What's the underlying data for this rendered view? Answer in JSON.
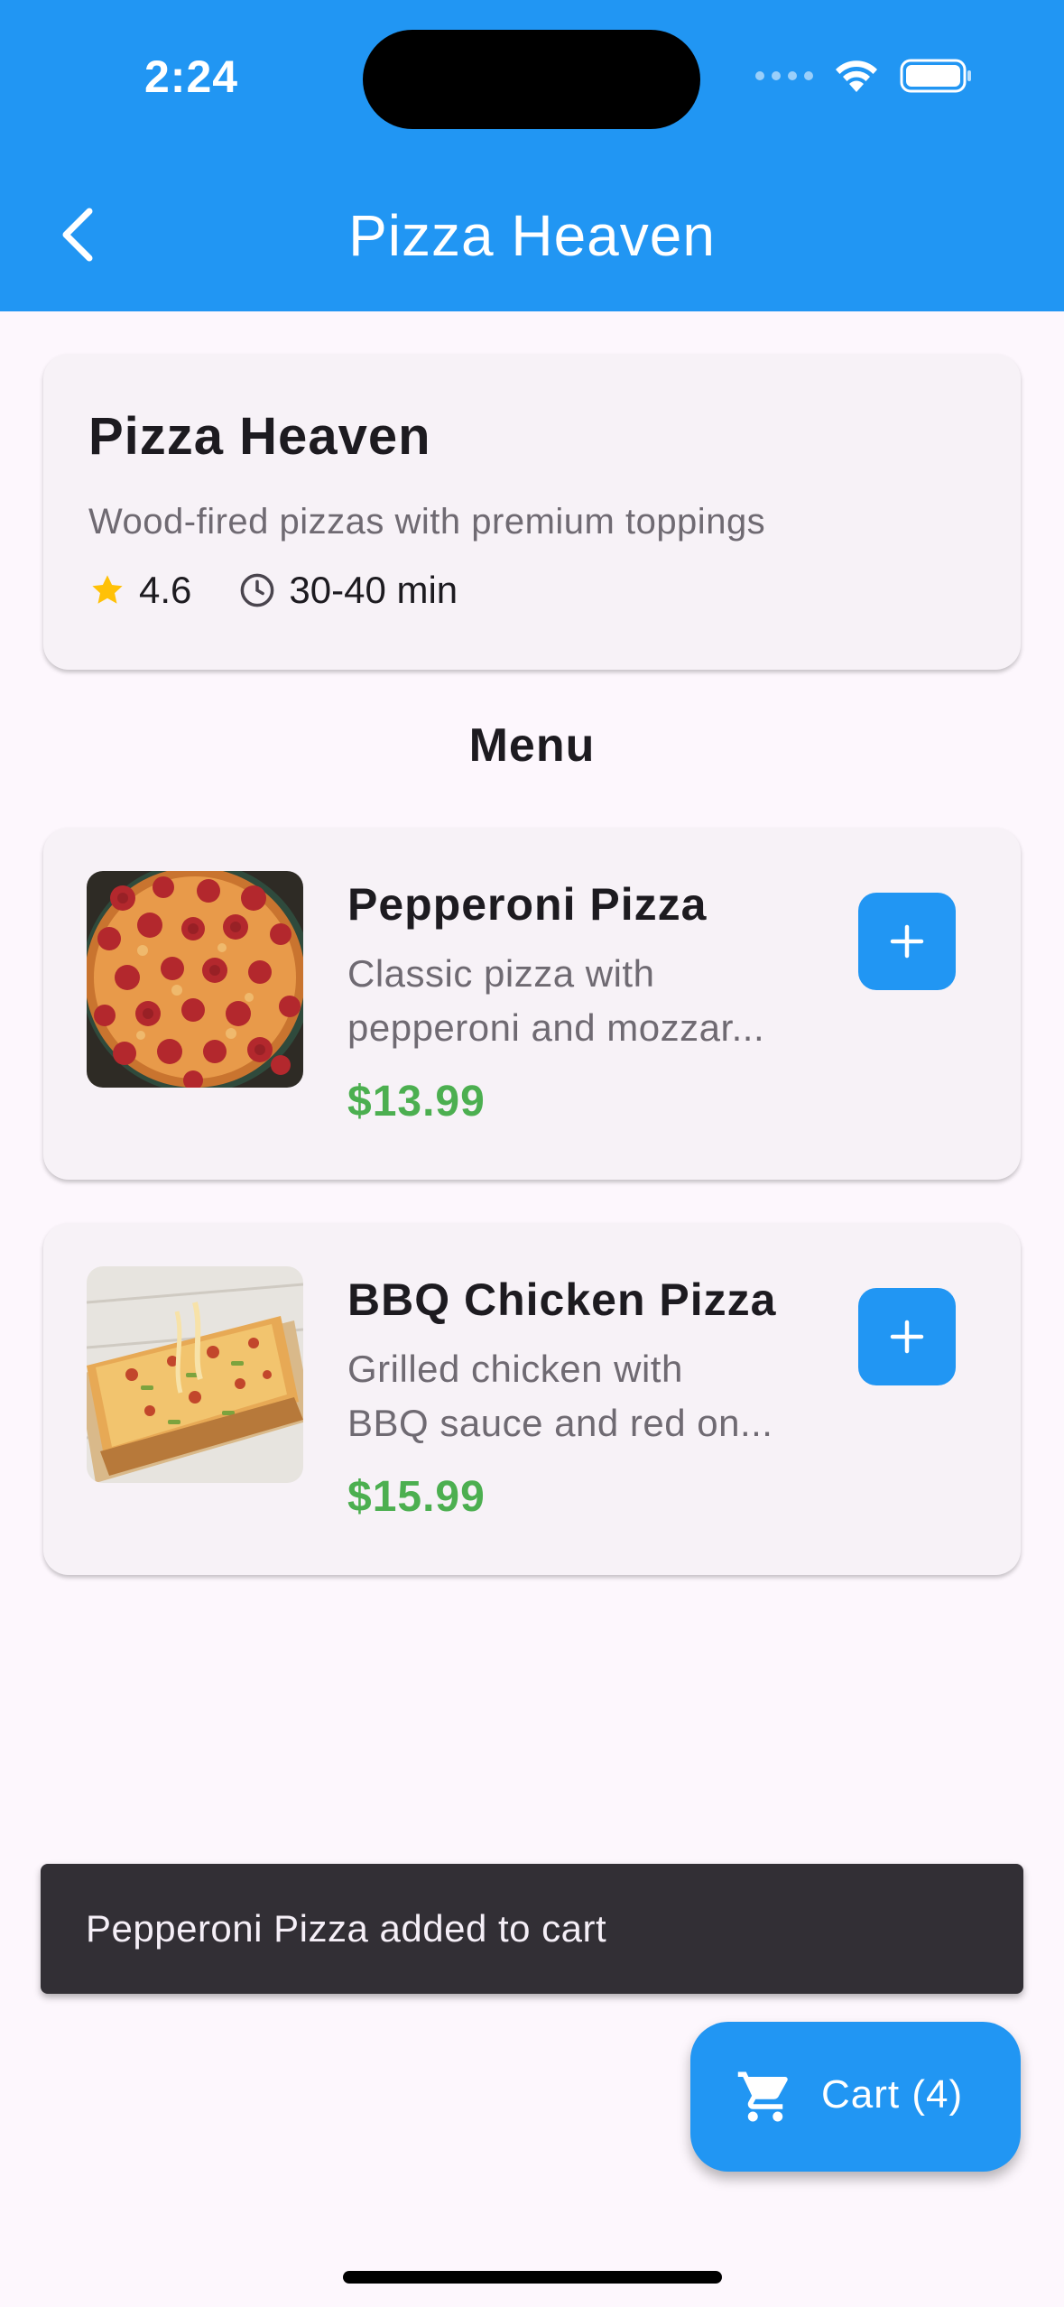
{
  "status_bar": {
    "time": "2:24"
  },
  "header": {
    "title": "Pizza Heaven",
    "back_icon": "chevron-left-icon"
  },
  "restaurant": {
    "name": "Pizza Heaven",
    "description": "Wood-fired pizzas with premium toppings",
    "rating": "4.6",
    "delivery_time": "30-40 min",
    "rating_color": "#FFC107"
  },
  "menu": {
    "heading": "Menu",
    "items": [
      {
        "name": "Pepperoni Pizza",
        "description_lines": [
          "Classic pizza with",
          "pepperoni and mozzar..."
        ],
        "price": "$13.99",
        "add_icon": "plus-icon"
      },
      {
        "name": "BBQ Chicken Pizza",
        "description_lines": [
          "Grilled chicken with",
          "BBQ sauce and red on..."
        ],
        "price": "$15.99",
        "add_icon": "plus-icon"
      }
    ]
  },
  "snackbar": {
    "message": "Pepperoni Pizza added to cart"
  },
  "cart_button": {
    "label": "Cart (4)",
    "icon": "shopping-cart-icon"
  },
  "colors": {
    "primary": "#2196F3",
    "price": "#4CAF50",
    "background": "#FDF7FD",
    "card": "#F7F2F7",
    "snackbar": "#322F35"
  }
}
